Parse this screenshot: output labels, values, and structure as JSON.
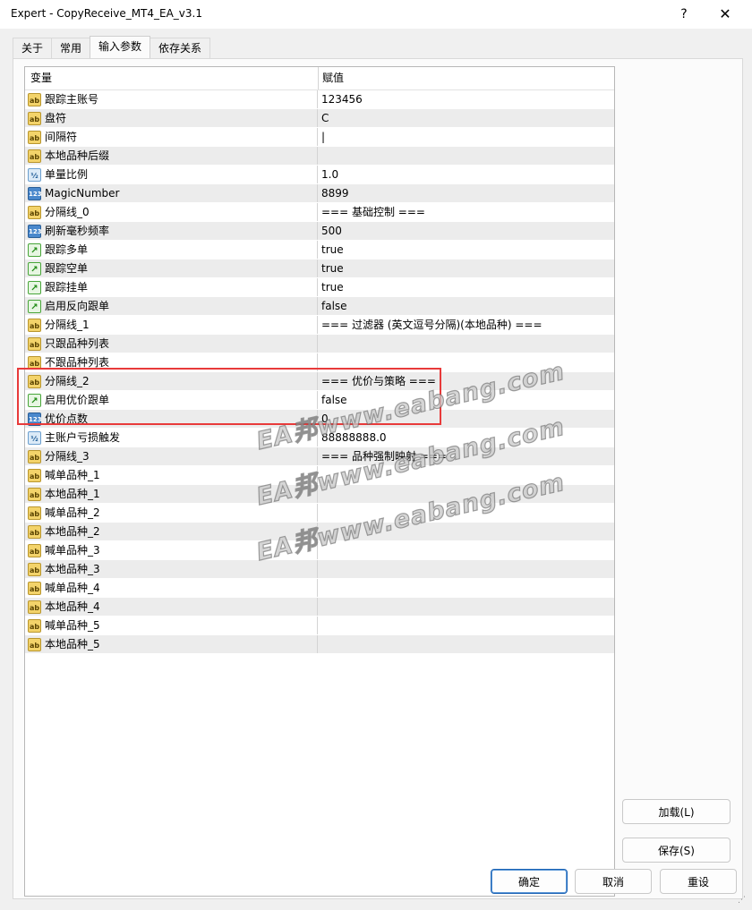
{
  "window": {
    "title": "Expert - CopyReceive_MT4_EA_v3.1",
    "help": "?",
    "close": "✕"
  },
  "tabs": [
    "关于",
    "常用",
    "输入参数",
    "依存关系"
  ],
  "active_tab": 2,
  "grid": {
    "headers": {
      "variable": "变量",
      "value": "赋值"
    },
    "rows": [
      {
        "icon": "ab",
        "label": "跟踪主账号",
        "value": "123456"
      },
      {
        "icon": "ab",
        "label": "盘符",
        "value": "C"
      },
      {
        "icon": "ab",
        "label": "间隔符",
        "value": "|"
      },
      {
        "icon": "ab",
        "label": "本地品种后缀",
        "value": ""
      },
      {
        "icon": "half",
        "label": "单量比例",
        "value": "1.0"
      },
      {
        "icon": "num",
        "label": "MagicNumber",
        "value": "8899"
      },
      {
        "icon": "ab",
        "label": "分隔线_0",
        "value": "=== 基础控制 ==="
      },
      {
        "icon": "num",
        "label": "刷新毫秒频率",
        "value": "500"
      },
      {
        "icon": "bool",
        "label": "跟踪多单",
        "value": "true"
      },
      {
        "icon": "bool",
        "label": "跟踪空单",
        "value": "true"
      },
      {
        "icon": "bool",
        "label": "跟踪挂单",
        "value": "true"
      },
      {
        "icon": "bool",
        "label": "启用反向跟单",
        "value": "false"
      },
      {
        "icon": "ab",
        "label": "分隔线_1",
        "value": "=== 过滤器 (英文逗号分隔)(本地品种) ==="
      },
      {
        "icon": "ab",
        "label": "只跟品种列表",
        "value": ""
      },
      {
        "icon": "ab",
        "label": "不跟品种列表",
        "value": ""
      },
      {
        "icon": "ab",
        "label": "分隔线_2",
        "value": "=== 优价与策略 ==="
      },
      {
        "icon": "bool",
        "label": "启用优价跟单",
        "value": "false"
      },
      {
        "icon": "num",
        "label": "优价点数",
        "value": "0"
      },
      {
        "icon": "half",
        "label": "主账户亏损触发",
        "value": "88888888.0"
      },
      {
        "icon": "ab",
        "label": "分隔线_3",
        "value": "=== 品种强制映射 ==="
      },
      {
        "icon": "ab",
        "label": "喊单品种_1",
        "value": ""
      },
      {
        "icon": "ab",
        "label": "本地品种_1",
        "value": ""
      },
      {
        "icon": "ab",
        "label": "喊单品种_2",
        "value": ""
      },
      {
        "icon": "ab",
        "label": "本地品种_2",
        "value": ""
      },
      {
        "icon": "ab",
        "label": "喊单品种_3",
        "value": ""
      },
      {
        "icon": "ab",
        "label": "本地品种_3",
        "value": ""
      },
      {
        "icon": "ab",
        "label": "喊单品种_4",
        "value": ""
      },
      {
        "icon": "ab",
        "label": "本地品种_4",
        "value": ""
      },
      {
        "icon": "ab",
        "label": "喊单品种_5",
        "value": ""
      },
      {
        "icon": "ab",
        "label": "本地品种_5",
        "value": ""
      }
    ]
  },
  "icon_glyphs": {
    "ab": "ab",
    "half": "½",
    "num": "123",
    "bool": "↗"
  },
  "watermark": "EA邦www.eabang.com",
  "buttons": {
    "load": "加载(L)",
    "save": "保存(S)",
    "ok": "确定",
    "cancel": "取消",
    "reset": "重设"
  },
  "colors": {
    "highlight_box": "#e83a3a",
    "primary_button_border": "#1d64b5"
  }
}
